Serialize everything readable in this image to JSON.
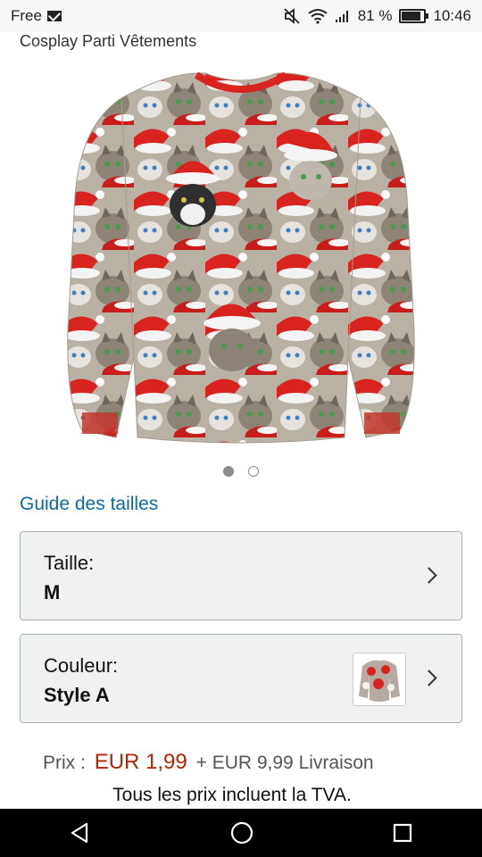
{
  "status_bar": {
    "carrier": "Free",
    "battery_percent": "81 %",
    "time": "10:46"
  },
  "product": {
    "category": "Cosplay Parti Vêtements",
    "carousel": {
      "active_index": 0,
      "total": 2
    }
  },
  "size_guide_label": "Guide des tailles",
  "size_selector": {
    "label": "Taille:",
    "value": "M"
  },
  "color_selector": {
    "label": "Couleur:",
    "value": "Style A"
  },
  "pricing": {
    "prefix": "Prix :",
    "price": "EUR 1,99",
    "shipping": "+ EUR 9,99 Livraison",
    "vat_note": "Tous les prix incluent la TVA."
  },
  "colors": {
    "link": "#0a6aa1",
    "price": "#b12704",
    "selector_bg": "#f0f2f2"
  },
  "icons": {
    "status": [
      "mail-icon",
      "mute-icon",
      "wifi-icon",
      "signal-icon",
      "battery-icon"
    ],
    "nav": [
      "back-icon",
      "home-icon",
      "recents-icon"
    ]
  }
}
